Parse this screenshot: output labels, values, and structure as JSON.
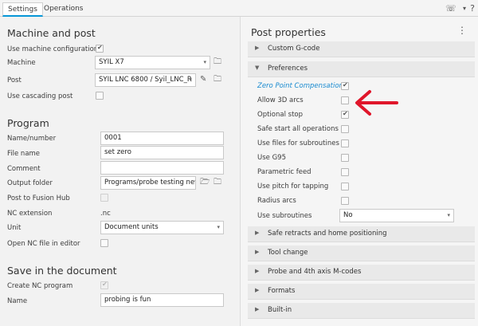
{
  "tabs": [
    "Settings",
    "Operations"
  ],
  "left": {
    "machine_post": {
      "title": "Machine and post",
      "use_machine_configuration": {
        "label": "Use machine configuration",
        "checked": true
      },
      "machine": {
        "label": "Machine",
        "value": "SYIL X7"
      },
      "post": {
        "label": "Post",
        "value": "SYIL LNC 6800 / Syil_LNC_R"
      },
      "use_cascading_post": {
        "label": "Use cascading post",
        "checked": false
      }
    },
    "program": {
      "title": "Program",
      "name_number": {
        "label": "Name/number",
        "value": "0001"
      },
      "file_name": {
        "label": "File name",
        "value": "set zero"
      },
      "comment": {
        "label": "Comment",
        "value": ""
      },
      "output_folder": {
        "label": "Output folder",
        "value": "Programs/probe testing new"
      },
      "post_to_fusion_hub": {
        "label": "Post to Fusion Hub",
        "checked": false
      },
      "nc_extension": {
        "label": "NC extension",
        "value": ".nc"
      },
      "unit": {
        "label": "Unit",
        "value": "Document units"
      },
      "open_nc_file": {
        "label": "Open NC file in editor",
        "checked": false
      }
    },
    "save_doc": {
      "title": "Save in the document",
      "create_nc_program": {
        "label": "Create NC program",
        "checked": true
      },
      "name": {
        "label": "Name",
        "value": "probing is fun"
      }
    }
  },
  "right": {
    "title": "Post properties",
    "groups": {
      "custom_gcode": "Custom G-code",
      "preferences": "Preferences",
      "safe_retracts": "Safe retracts and home positioning",
      "tool_change": "Tool change",
      "probe_4th": "Probe and 4th axis M-codes",
      "formats": "Formats",
      "builtin": "Built-in"
    },
    "preferences": [
      {
        "label": "Zero Point Compensation",
        "checked": true
      },
      {
        "label": "Allow 3D arcs",
        "checked": false
      },
      {
        "label": "Optional stop",
        "checked": true
      },
      {
        "label": "Safe start all operations",
        "checked": false
      },
      {
        "label": "Use files for subroutines",
        "checked": false
      },
      {
        "label": "Use G95",
        "checked": false
      },
      {
        "label": "Parametric feed",
        "checked": false
      },
      {
        "label": "Use pitch for tapping",
        "checked": false
      },
      {
        "label": "Radius arcs",
        "checked": false
      }
    ],
    "use_subroutines": {
      "label": "Use subroutines",
      "value": "No"
    }
  },
  "colors": {
    "accent": "#0696d7",
    "link": "#1a8bd0",
    "arrow": "#e0162b"
  },
  "icons": [
    "phone-icon",
    "help-icon",
    "folder-icon",
    "edit-icon",
    "folder-cloud-icon",
    "kebab-menu-icon",
    "chevron-right-icon",
    "chevron-down-icon",
    "annotation-arrow"
  ]
}
